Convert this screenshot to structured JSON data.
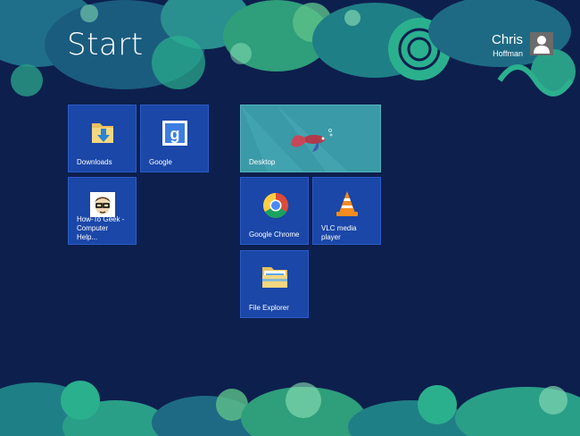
{
  "header": {
    "title": "Start"
  },
  "user": {
    "first_name": "Chris",
    "last_name": "Hoffman"
  },
  "tiles": [
    {
      "label": "Downloads",
      "icon": "folder-download-icon"
    },
    {
      "label": "Google",
      "icon": "google-icon"
    },
    {
      "label": "How-To Geek - Computer Help...",
      "icon": "howtogeek-icon"
    },
    {
      "label": "Desktop",
      "icon": "betta-fish-wallpaper"
    },
    {
      "label": "Google Chrome",
      "icon": "chrome-icon"
    },
    {
      "label": "VLC media player",
      "icon": "vlc-cone-icon"
    },
    {
      "label": "File Explorer",
      "icon": "file-explorer-icon"
    }
  ],
  "colors": {
    "background": "#0d1f4d",
    "tile": "#1a47a8",
    "desktop_tile": "#3a9aa7",
    "decoration": "#2bb08e"
  }
}
